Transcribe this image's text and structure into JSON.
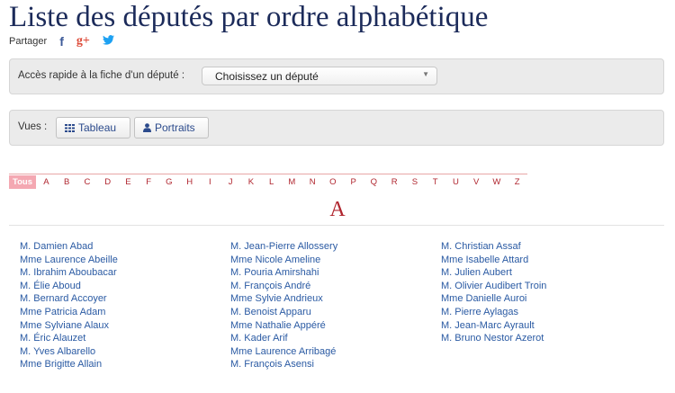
{
  "page": {
    "title": "Liste des députés par ordre alphabétique"
  },
  "share": {
    "label": "Partager",
    "facebook_glyph": "f",
    "googleplus_glyph": "g+",
    "twitter_glyph": "🐦"
  },
  "quick_access": {
    "label": "Accès rapide à  la fiche d'un député :",
    "select_value": "Choisissez un député"
  },
  "views": {
    "label": "Vues :",
    "table_label": "Tableau",
    "portraits_label": "Portraits"
  },
  "alphabet": [
    "Tous",
    "A",
    "B",
    "C",
    "D",
    "E",
    "F",
    "G",
    "H",
    "I",
    "J",
    "K",
    "L",
    "M",
    "N",
    "O",
    "P",
    "Q",
    "R",
    "S",
    "T",
    "U",
    "V",
    "W",
    "Z"
  ],
  "section": {
    "letter": "A"
  },
  "deputes": {
    "col1": [
      "M. Damien Abad",
      "Mme Laurence Abeille",
      "M. Ibrahim Aboubacar",
      "M. Élie Aboud",
      "M. Bernard Accoyer",
      "Mme Patricia Adam",
      "Mme Sylviane Alaux",
      "M. Éric Alauzet",
      "M. Yves Albarello",
      "Mme Brigitte Allain"
    ],
    "col2": [
      "M. Jean-Pierre Allossery",
      "Mme Nicole Ameline",
      "M. Pouria Amirshahi",
      "M. François André",
      "Mme Sylvie Andrieux",
      "M. Benoist Apparu",
      "Mme Nathalie Appéré",
      "M. Kader Arif",
      "Mme Laurence Arribagé",
      "M. François Asensi"
    ],
    "col3": [
      "M. Christian Assaf",
      "Mme Isabelle Attard",
      "M. Julien Aubert",
      "M. Olivier Audibert Troin",
      "Mme Danielle Auroi",
      "M. Pierre Aylagas",
      "M. Jean-Marc Ayrault",
      "M. Bruno Nestor Azerot"
    ]
  }
}
